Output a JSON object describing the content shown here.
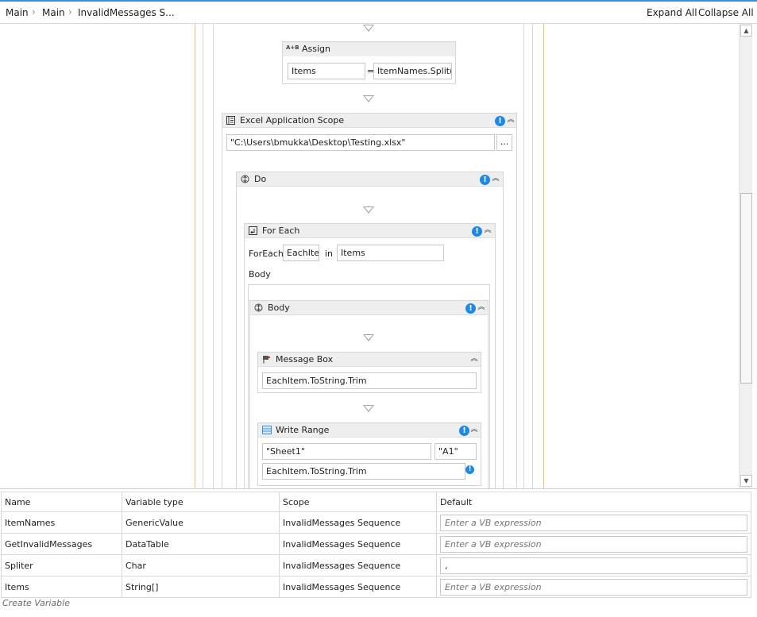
{
  "breadcrumb": {
    "items": [
      "Main",
      "Main",
      "InvalidMessages S..."
    ]
  },
  "toolbar": {
    "expand_all": "Expand All",
    "collapse_all": "Collapse All"
  },
  "assign": {
    "title": "Assign",
    "icon_text": "A+B",
    "left": "Items",
    "equals": "=",
    "right": "ItemNames.Split(S("
  },
  "excel_scope": {
    "title": "Excel Application Scope",
    "path": "\"C:\\Users\\bmukka\\Desktop\\Testing.xlsx\"",
    "browse_label": "..."
  },
  "do_seq": {
    "title": "Do"
  },
  "for_each": {
    "title": "For Each",
    "foreach_label": "ForEach",
    "item_var": "EachIten",
    "in_label": "in",
    "collection": "Items",
    "body_label": "Body"
  },
  "body_seq": {
    "title": "Body"
  },
  "message_box": {
    "title": "Message Box",
    "text": "EachItem.ToString.Trim"
  },
  "write_range": {
    "title": "Write Range",
    "sheet": "\"Sheet1\"",
    "cell": "\"A1\"",
    "data": "EachItem.ToString.Trim"
  },
  "variables": {
    "columns": [
      "Name",
      "Variable type",
      "Scope",
      "Default"
    ],
    "rows": [
      {
        "name": "ItemNames",
        "type": "GenericValue",
        "scope": "InvalidMessages Sequence",
        "default": "",
        "placeholder": "Enter a VB expression"
      },
      {
        "name": "GetInvalidMessages",
        "type": "DataTable",
        "scope": "InvalidMessages Sequence",
        "default": "",
        "placeholder": "Enter a VB expression"
      },
      {
        "name": "Spliter",
        "type": "Char",
        "scope": "InvalidMessages Sequence",
        "default": ",",
        "placeholder": ""
      },
      {
        "name": "Items",
        "type": "String[]",
        "scope": "InvalidMessages Sequence",
        "default": "",
        "placeholder": "Enter a VB expression"
      }
    ],
    "create_label": "Create Variable"
  },
  "colors": {
    "accent": "#3c8fd6",
    "info": "#1e88e5",
    "scope_line": "#f5c26b",
    "header_bg": "#eeeeee"
  },
  "icons": {
    "breadcrumb_sep": "chevron-right-icon",
    "assign": "assign-icon",
    "excel": "excel-scope-icon",
    "sequence": "sequence-icon",
    "foreach": "foreach-icon",
    "message": "message-box-icon",
    "write": "write-range-icon",
    "info": "info-icon",
    "collapse": "collapse-icon"
  }
}
